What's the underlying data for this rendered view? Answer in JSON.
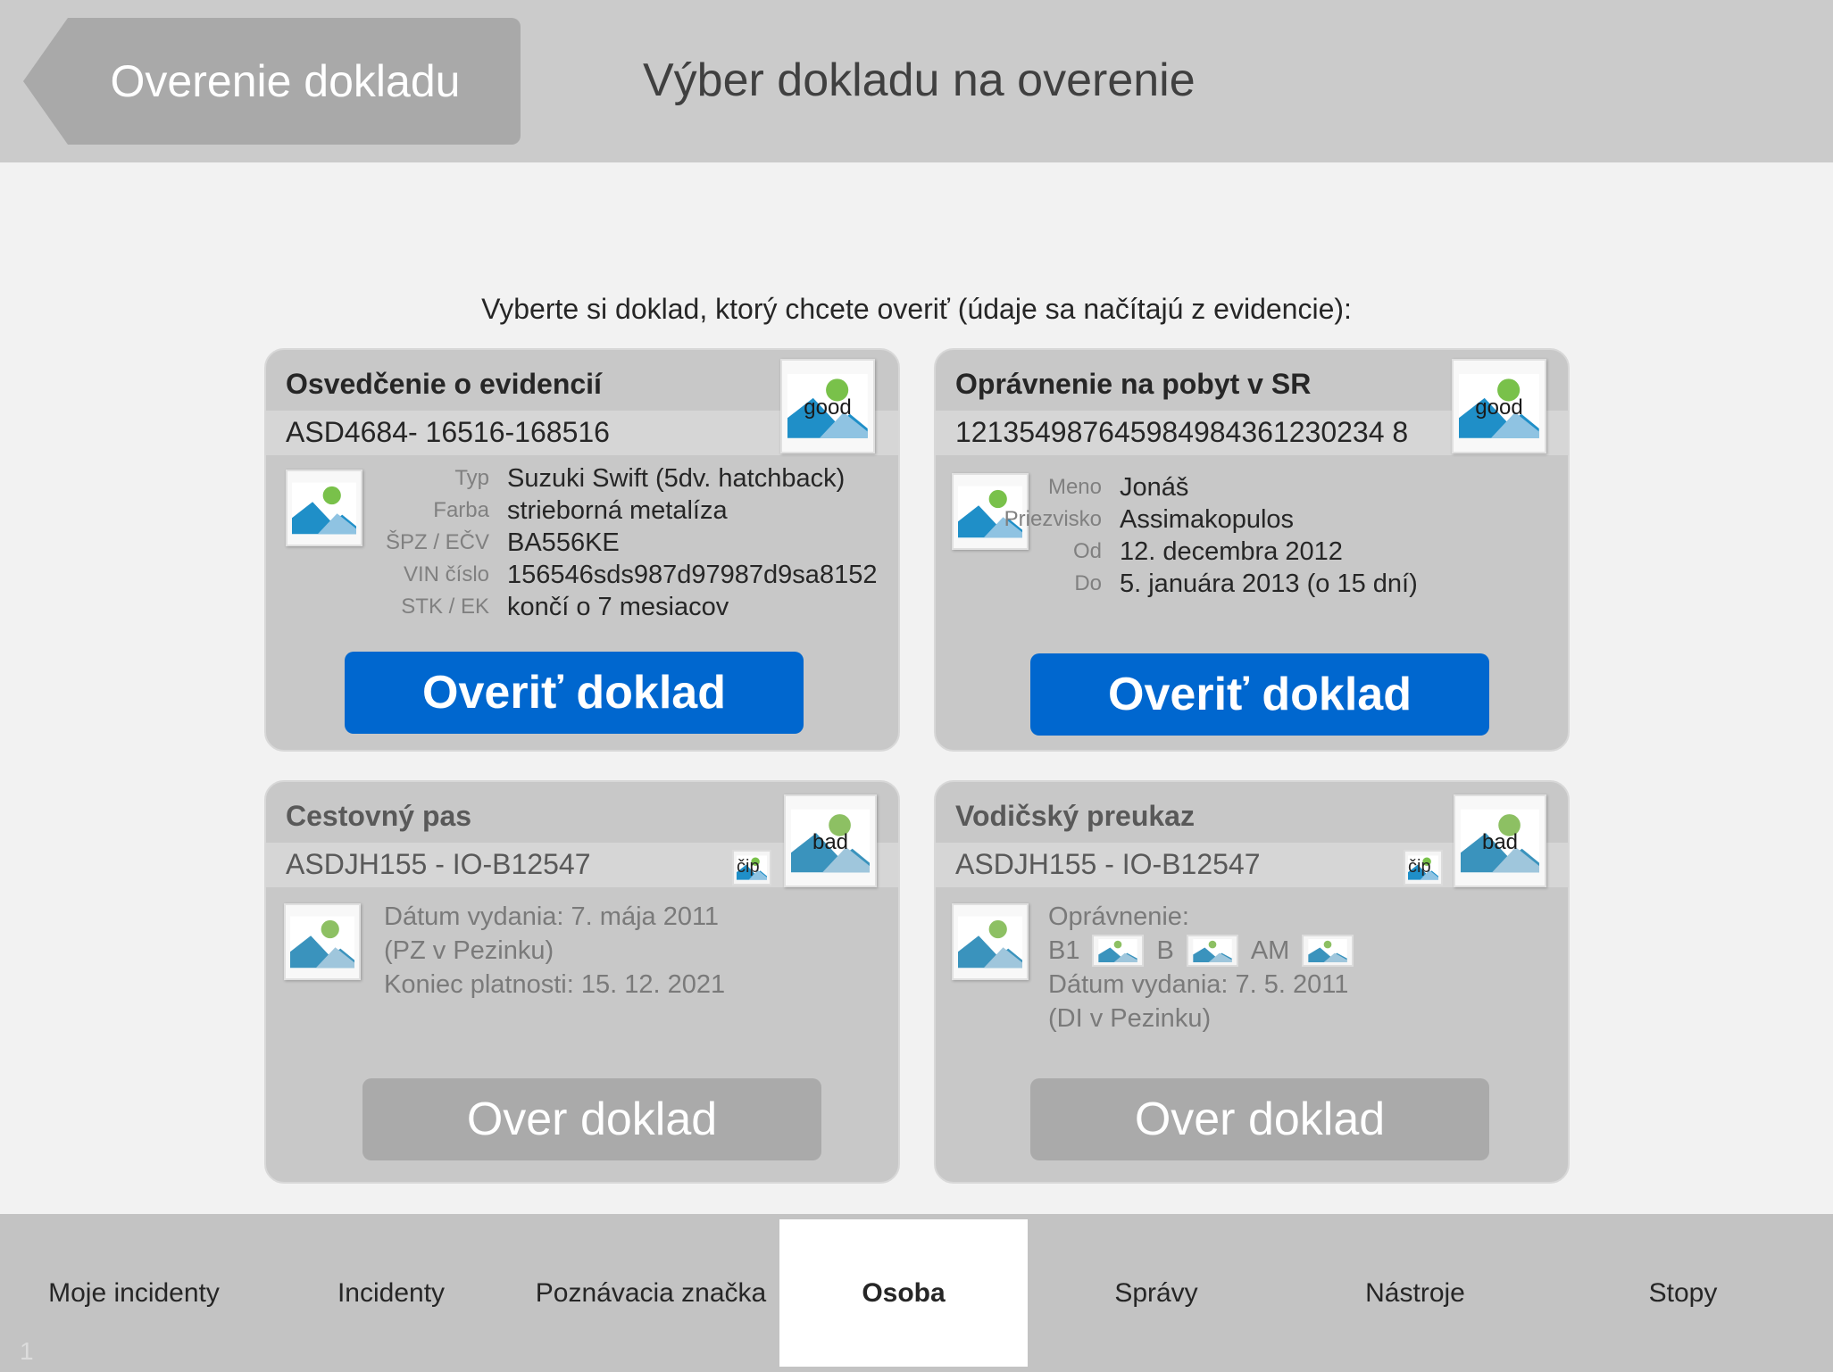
{
  "header": {
    "back_label": "Overenie dokladu",
    "title": "Výber dokladu na overenie"
  },
  "instruction": "Vyberte si doklad, ktorý chcete overiť (údaje sa načítajú z evidencie):",
  "cards": [
    {
      "title": "Osvedčenie o evidencií",
      "number": "ASD4684- 16516-168516",
      "status_tag": "good",
      "fields": [
        {
          "label": "Typ",
          "value": "Suzuki Swift (5dv. hatchback)"
        },
        {
          "label": "Farba",
          "value": "strieborná metalíza"
        },
        {
          "label": "ŠPZ / EČV",
          "value": "BA556KE"
        },
        {
          "label": "VIN číslo",
          "value": "156546sds987d97987d9sa8152"
        },
        {
          "label": "STK / EK",
          "value": "končí o 7 mesiacov"
        }
      ],
      "button": "Overiť doklad",
      "enabled": true
    },
    {
      "title": "Oprávnenie na pobyt v SR",
      "number": "121354987645984984361230234 8",
      "status_tag": "good",
      "fields": [
        {
          "label": "Meno",
          "value": "Jonáš"
        },
        {
          "label": "Priezvisko",
          "value": "Assimakopulos"
        },
        {
          "label": "Od",
          "value": "12. decembra 2012"
        },
        {
          "label": "Do",
          "value": "5. januára 2013 (o 15 dní)"
        }
      ],
      "button": "Overiť doklad",
      "enabled": true
    },
    {
      "title": "Cestovný pas",
      "number": "ASDJH155 - IO-B12547",
      "status_tag": "bad",
      "chip_tag": "čip",
      "lines": [
        "Dátum vydania: 7. mája 2011",
        "(PZ v Pezinku)",
        "Koniec platnosti: 15. 12. 2021"
      ],
      "button": "Over doklad",
      "enabled": false
    },
    {
      "title": "Vodičský preukaz",
      "number": "ASDJH155 - IO-B12547",
      "status_tag": "bad",
      "chip_tag": "čip",
      "permit_label": "Oprávnenie:",
      "permits": [
        "B1",
        "B",
        "AM"
      ],
      "lines": [
        "Dátum vydania: 7. 5. 2011",
        "(DI v Pezinku)"
      ],
      "button": "Over doklad",
      "enabled": false
    }
  ],
  "nav": {
    "items": [
      "Moje incidenty",
      "Incidenty",
      "Poznávacia značka",
      "Osoba",
      "Správy",
      "Nástroje",
      "Stopy"
    ],
    "active": "Osoba"
  },
  "page_number": "1",
  "icons": {
    "photo": "image-placeholder-icon",
    "chip": "chip-icon",
    "back": "back-arrow-icon"
  },
  "colors": {
    "primary_button": "#0067cf",
    "disabled_button": "#aaaaaa",
    "card_bg": "#c8c8c8",
    "header_bg": "#cbcbcb"
  }
}
